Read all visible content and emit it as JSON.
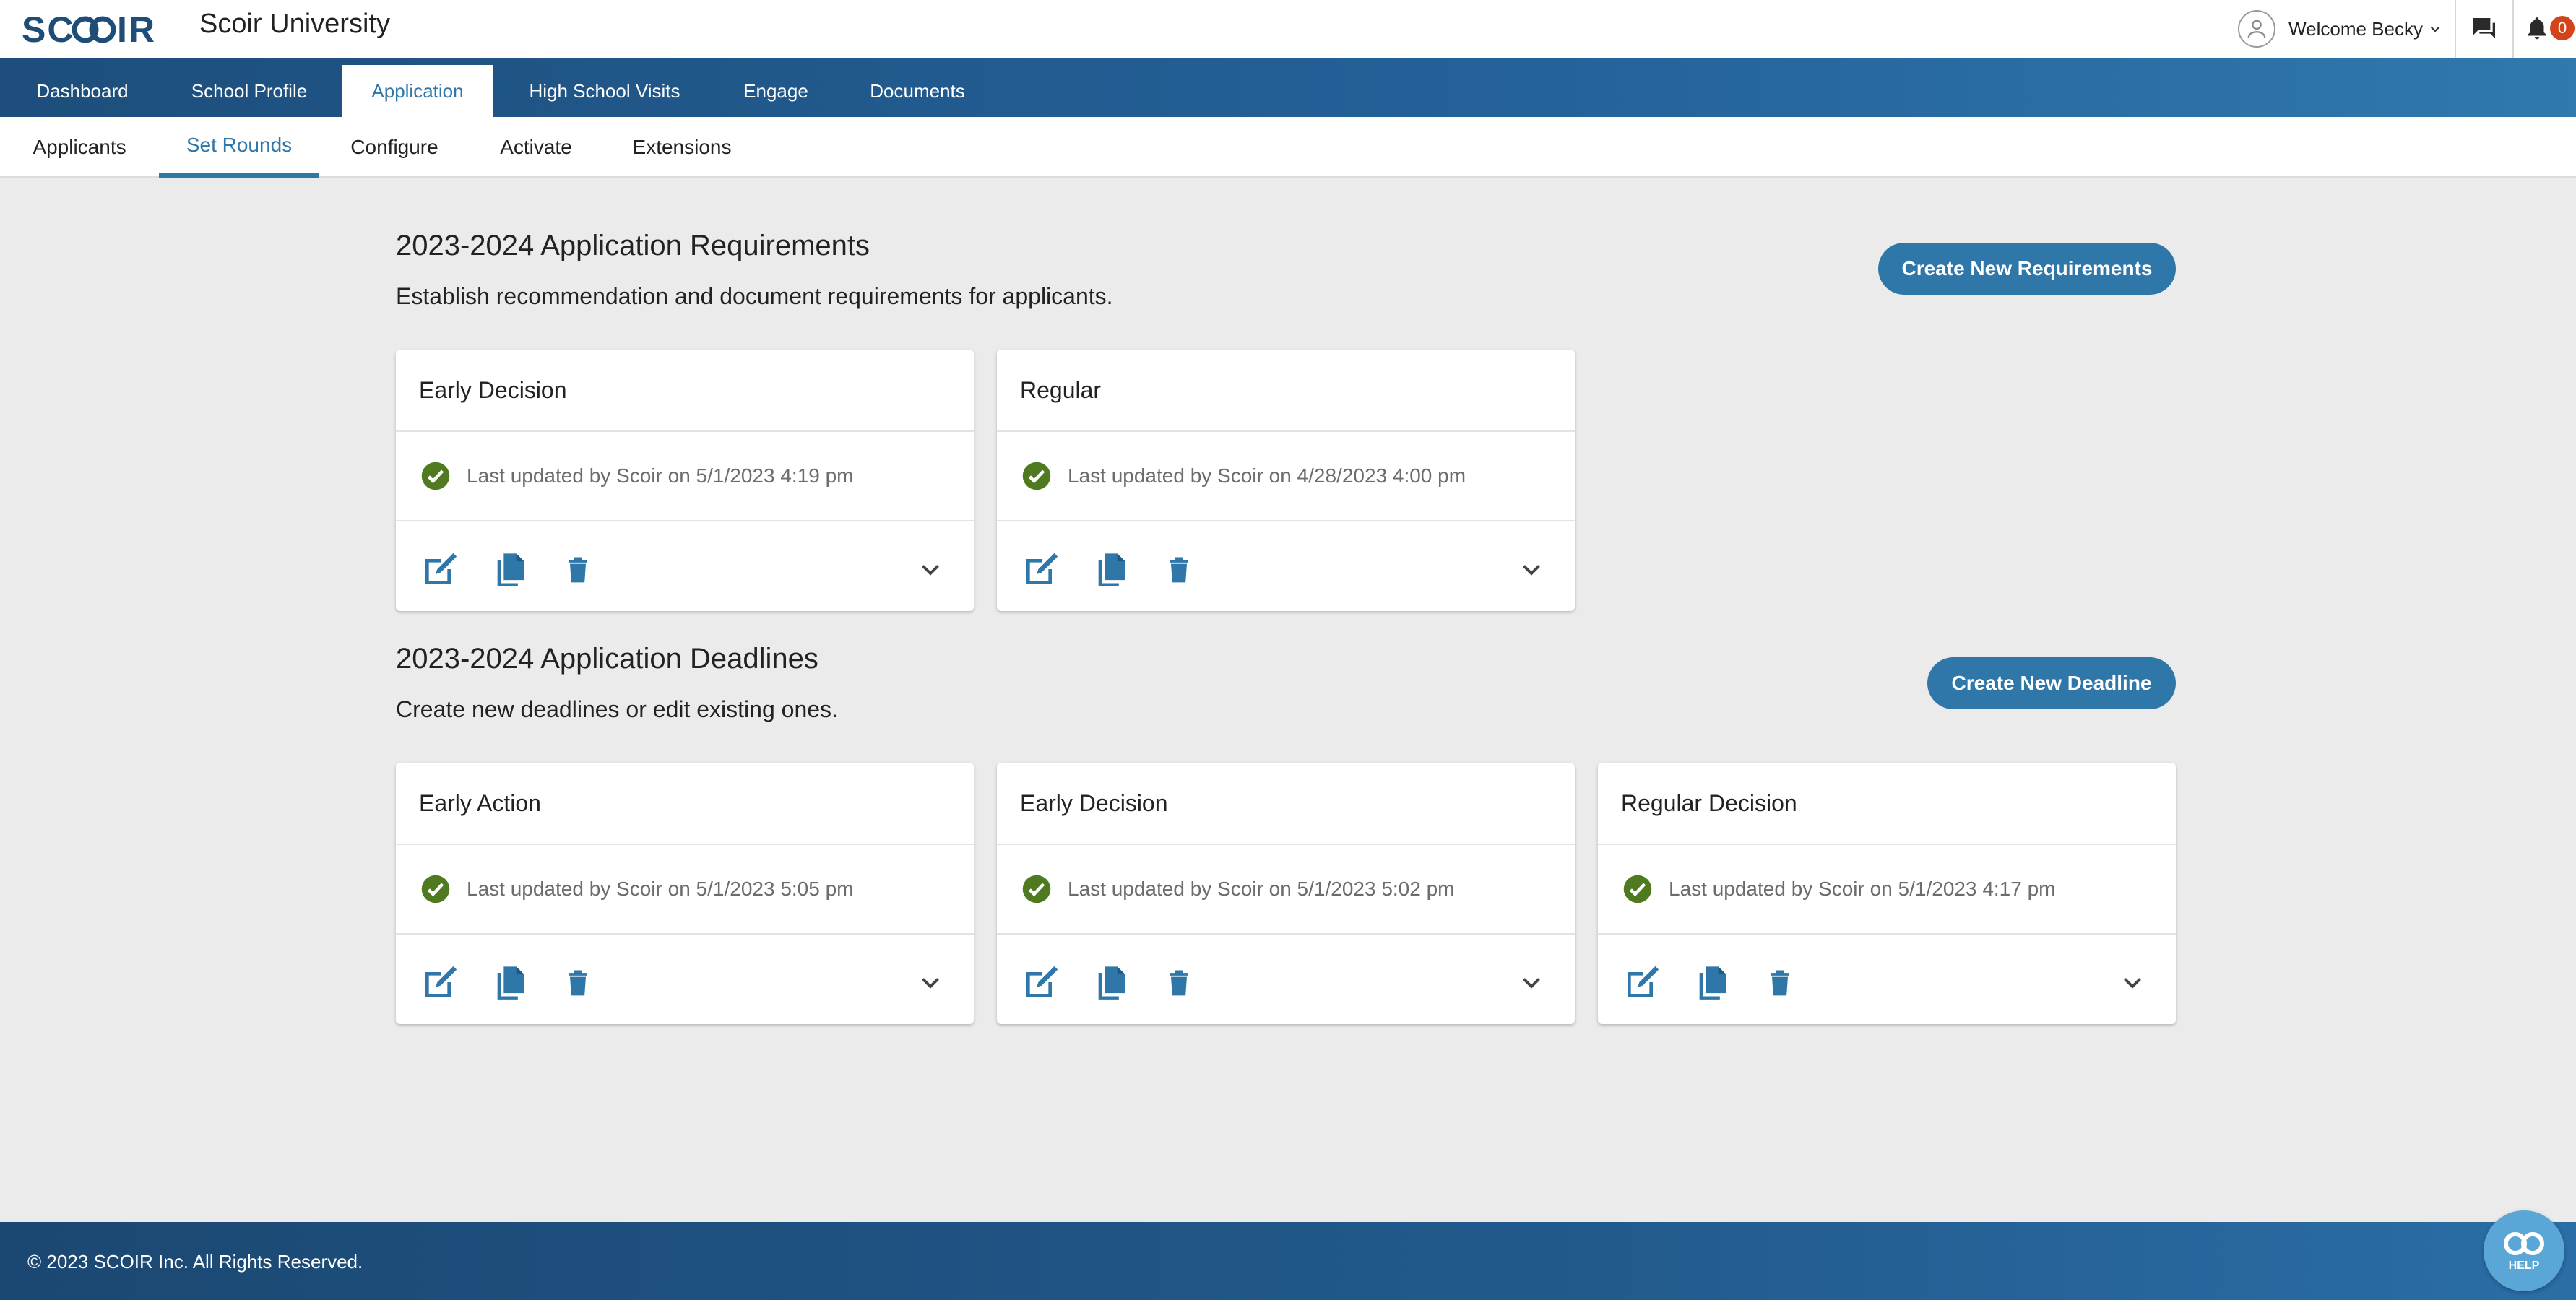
{
  "header": {
    "logo_text": "SCOIR",
    "app_title": "Scoir University",
    "welcome": "Welcome Becky",
    "notification_count": "0"
  },
  "main_nav": {
    "items": [
      {
        "label": "Dashboard"
      },
      {
        "label": "School Profile"
      },
      {
        "label": "Application"
      },
      {
        "label": "High School Visits"
      },
      {
        "label": "Engage"
      },
      {
        "label": "Documents"
      }
    ],
    "active": "Application"
  },
  "sub_nav": {
    "items": [
      {
        "label": "Applicants"
      },
      {
        "label": "Set Rounds"
      },
      {
        "label": "Configure"
      },
      {
        "label": "Activate"
      },
      {
        "label": "Extensions"
      }
    ],
    "active": "Set Rounds"
  },
  "requirements": {
    "title": "2023-2024 Application Requirements",
    "description": "Establish recommendation and document requirements for applicants.",
    "button_label": "Create New Requirements",
    "cards": [
      {
        "name": "Early Decision",
        "status": "Last updated by Scoir on 5/1/2023 4:19 pm"
      },
      {
        "name": "Regular",
        "status": "Last updated by Scoir on 4/28/2023 4:00 pm"
      }
    ]
  },
  "deadlines": {
    "title": "2023-2024 Application Deadlines",
    "description": "Create new deadlines or edit existing ones.",
    "button_label": "Create New Deadline",
    "cards": [
      {
        "name": "Early Action",
        "status": "Last updated by Scoir on 5/1/2023 5:05 pm"
      },
      {
        "name": "Early Decision",
        "status": "Last updated by Scoir on 5/1/2023 5:02 pm"
      },
      {
        "name": "Regular Decision",
        "status": "Last updated by Scoir on 5/1/2023 4:17 pm"
      }
    ]
  },
  "card_actions": [
    "edit-icon",
    "copy-icon",
    "trash-icon",
    "chevron-down-icon"
  ],
  "footer": {
    "copyright": "© 2023 SCOIR Inc. All Rights Reserved.",
    "help_label": "HELP"
  },
  "colors": {
    "brand_blue": "#2f77a8",
    "nav_dark": "#1d4e7c",
    "success_green": "#4f7a1f",
    "badge_red": "#d4441c"
  }
}
